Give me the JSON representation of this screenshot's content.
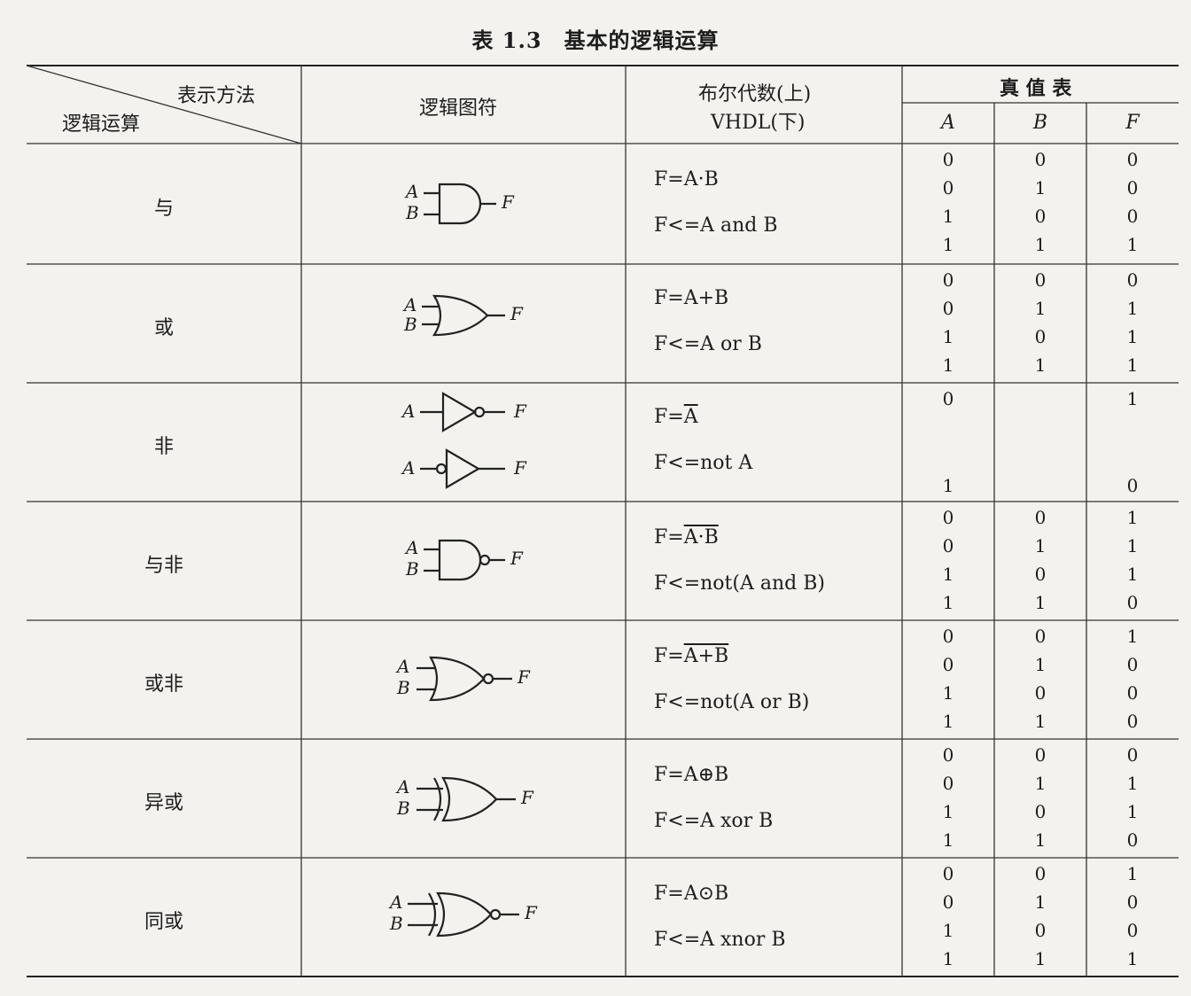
{
  "title": "表 1.3　基本的逻辑运算",
  "header": {
    "repr": "表示方法",
    "op": "逻辑运算",
    "symbol": "逻辑图符",
    "boolean_line1": "布尔代数(上)",
    "boolean_line2": "VHDL(下)",
    "truth": "真 值 表",
    "col_a": "A",
    "col_b": "B",
    "col_f": "F"
  },
  "rows": [
    {
      "name": "与",
      "bool": "F=A·B",
      "vhdl": "F<=A and B",
      "truth": [
        [
          "0",
          "0",
          "0"
        ],
        [
          "0",
          "1",
          "0"
        ],
        [
          "1",
          "0",
          "0"
        ],
        [
          "1",
          "1",
          "1"
        ]
      ]
    },
    {
      "name": "或",
      "bool": "F=A+B",
      "vhdl": "F<=A or B",
      "truth": [
        [
          "0",
          "0",
          "0"
        ],
        [
          "0",
          "1",
          "1"
        ],
        [
          "1",
          "0",
          "1"
        ],
        [
          "1",
          "1",
          "1"
        ]
      ]
    },
    {
      "name": "非",
      "bool": "F=Ā",
      "vhdl": "F<=not A",
      "truth": [
        [
          "0",
          "",
          "1"
        ],
        [
          "1",
          "",
          "0"
        ]
      ]
    },
    {
      "name": "与非",
      "bool": "F=A·B (overlined)",
      "vhdl": "F<=not(A and B)",
      "truth": [
        [
          "0",
          "0",
          "1"
        ],
        [
          "0",
          "1",
          "1"
        ],
        [
          "1",
          "0",
          "1"
        ],
        [
          "1",
          "1",
          "0"
        ]
      ]
    },
    {
      "name": "或非",
      "bool": "F=A+B (overlined)",
      "vhdl": "F<=not(A or B)",
      "truth": [
        [
          "0",
          "0",
          "1"
        ],
        [
          "0",
          "1",
          "0"
        ],
        [
          "1",
          "0",
          "0"
        ],
        [
          "1",
          "1",
          "0"
        ]
      ]
    },
    {
      "name": "异或",
      "bool": "F=A⊕B",
      "vhdl": "F<=A xor B",
      "truth": [
        [
          "0",
          "0",
          "0"
        ],
        [
          "0",
          "1",
          "1"
        ],
        [
          "1",
          "0",
          "1"
        ],
        [
          "1",
          "1",
          "0"
        ]
      ]
    },
    {
      "name": "同或",
      "bool": "F=A⊙B",
      "vhdl": "F<=A xnor B",
      "truth": [
        [
          "0",
          "0",
          "1"
        ],
        [
          "0",
          "1",
          "0"
        ],
        [
          "1",
          "0",
          "0"
        ],
        [
          "1",
          "1",
          "1"
        ]
      ]
    }
  ],
  "gate_labels": {
    "in_a": "A",
    "in_b": "B",
    "out_f": "F"
  }
}
